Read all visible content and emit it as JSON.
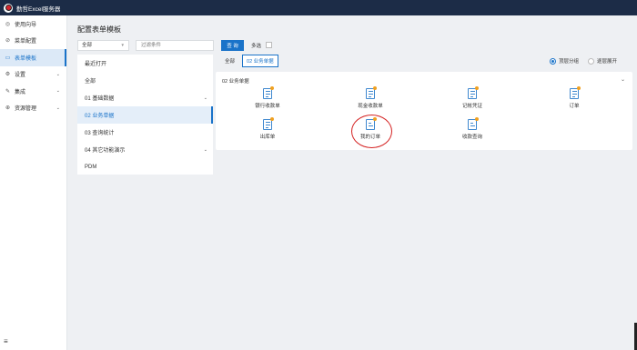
{
  "app": {
    "title": "勤哲Excel服务器"
  },
  "sidebar": {
    "items": [
      {
        "label": "使用向导",
        "icon": "compass-icon",
        "glyph": "◎",
        "active": false,
        "has_children": false
      },
      {
        "label": "菜单配置",
        "icon": "link-icon",
        "glyph": "⊘",
        "active": false,
        "has_children": false
      },
      {
        "label": "表单模板",
        "icon": "form-icon",
        "glyph": "▭",
        "active": true,
        "has_children": false
      },
      {
        "label": "设置",
        "icon": "gear-icon",
        "glyph": "⚙",
        "active": false,
        "has_children": true
      },
      {
        "label": "集成",
        "icon": "pen-icon",
        "glyph": "✎",
        "active": false,
        "has_children": true
      },
      {
        "label": "资源管理",
        "icon": "globe-icon",
        "glyph": "⊕",
        "active": false,
        "has_children": true
      }
    ],
    "menu_toggle_glyph": "≡"
  },
  "page": {
    "title": "配置表单模板",
    "category_select": "全部",
    "filter_placeholder": "过滤条件",
    "query_button": "查 询",
    "multi_select_label": "多选"
  },
  "categories": [
    {
      "label": "最近打开",
      "active": false,
      "has_children": false
    },
    {
      "label": "全部",
      "active": false,
      "has_children": false
    },
    {
      "label": "01 基础数据",
      "active": false,
      "has_children": true
    },
    {
      "label": "02 业务单据",
      "active": true,
      "has_children": false
    },
    {
      "label": "03 查询统计",
      "active": false,
      "has_children": false
    },
    {
      "label": "04 其它功能演示",
      "active": false,
      "has_children": true
    },
    {
      "label": "PDM",
      "active": false,
      "has_children": false
    }
  ],
  "tabs": [
    {
      "label": "全部",
      "active": false
    },
    {
      "label": "02 业务单据",
      "active": true
    }
  ],
  "view_mode": {
    "options": [
      {
        "label": "顶层分组",
        "selected": true
      },
      {
        "label": "逐层展开",
        "selected": false
      }
    ]
  },
  "group": {
    "title": "02 业务单据",
    "templates": [
      {
        "label": "银行收款单",
        "icon": "form-edit-icon",
        "highlighted": false
      },
      {
        "label": "现金收款单",
        "icon": "form-edit-icon",
        "highlighted": false
      },
      {
        "label": "记帐凭证",
        "icon": "form-edit-icon",
        "highlighted": false
      },
      {
        "label": "订单",
        "icon": "form-edit-icon",
        "highlighted": false
      },
      {
        "label": "出库单",
        "icon": "form-edit-icon",
        "highlighted": false
      },
      {
        "label": "我的订单",
        "icon": "query-form-icon",
        "highlighted": true
      },
      {
        "label": "收款查询",
        "icon": "query-form-icon",
        "highlighted": false
      }
    ]
  },
  "colors": {
    "topbar": "#1c2c47",
    "accent": "#1a73c9",
    "highlight_ring": "#d42020",
    "icon_badge": "#f0a020"
  }
}
